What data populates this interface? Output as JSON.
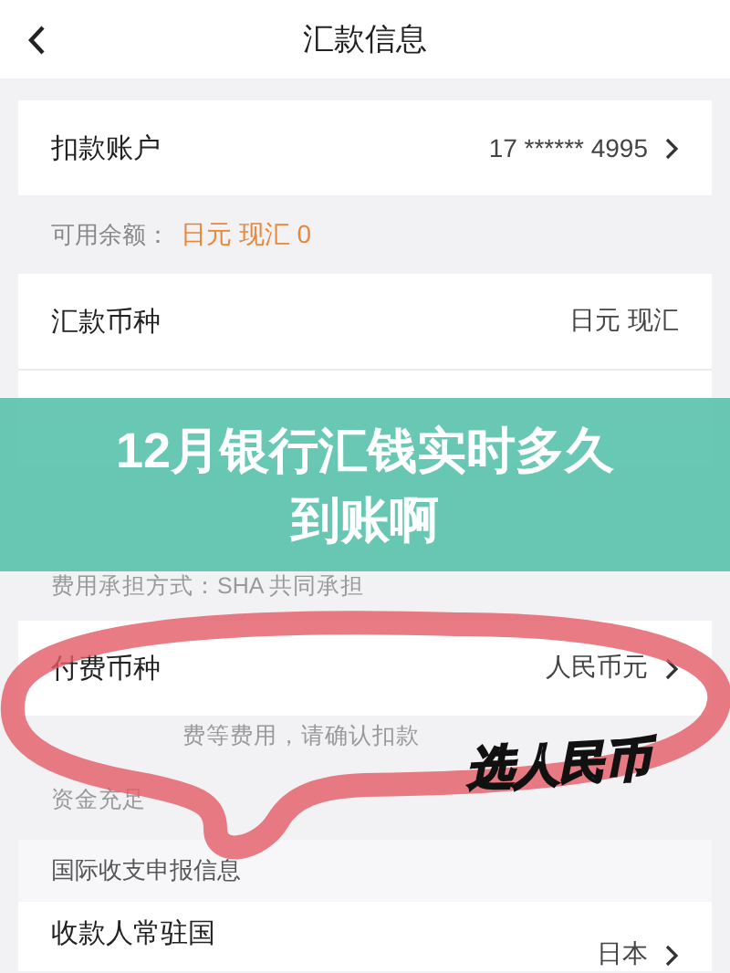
{
  "header": {
    "title": "汇款信息"
  },
  "account_row": {
    "label": "扣款账户",
    "value": "17 ****** 4995",
    "chevron": true
  },
  "balance": {
    "label": "可用余额：",
    "value": "日元 现汇 0"
  },
  "currency_rows": [
    {
      "label": "汇款币种",
      "value": "日元 现汇",
      "chevron": false
    }
  ],
  "transfer_note": "费用承担方式：SHA 共同承担",
  "fee_row": {
    "label": "付费币种",
    "value": "人民币元",
    "chevron": true
  },
  "fee_note_lines": [
    "费等费用，请确认扣款",
    "资金充足"
  ],
  "section_title": "国际收支申报信息",
  "payee_row": {
    "label": "收款人常驻国",
    "value": "日本",
    "chevron": true
  },
  "banner": {
    "title_lines": [
      "12月银行汇钱实时多久",
      "到账啊"
    ]
  },
  "annotation": {
    "text": "选人民币"
  }
}
